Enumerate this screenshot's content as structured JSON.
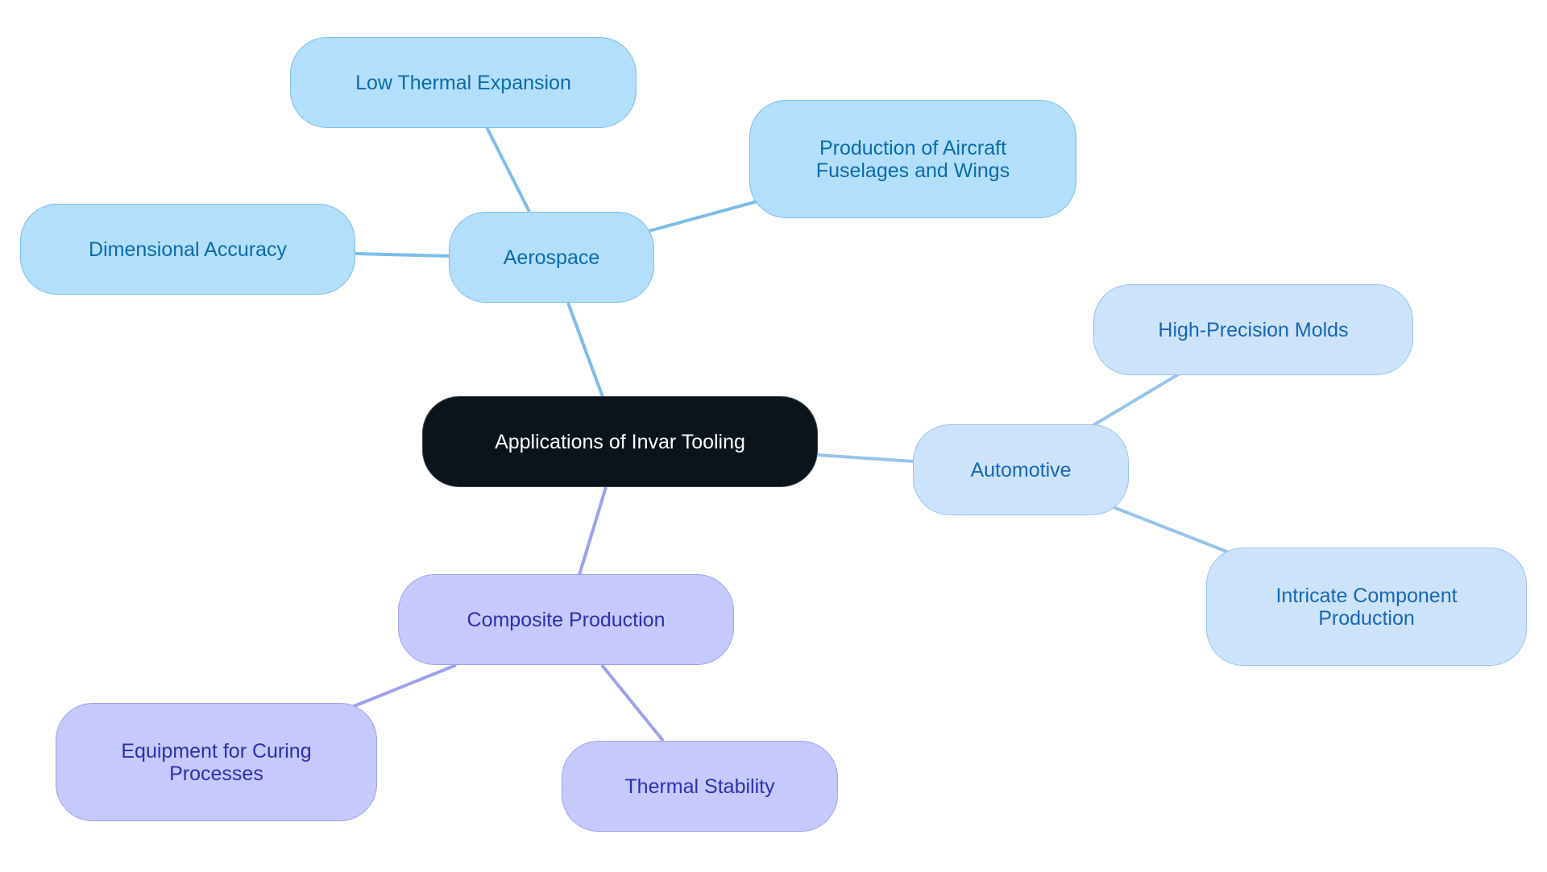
{
  "diagram": {
    "type": "mind-map",
    "root": {
      "id": "root",
      "label": "Applications of Invar Tooling"
    },
    "branches": [
      {
        "id": "aerospace",
        "label": "Aerospace",
        "color_group": "aero",
        "children": [
          {
            "id": "low-thermal",
            "label": "Low Thermal Expansion"
          },
          {
            "id": "aircraft",
            "label": "Production of Aircraft\nFuselages and Wings"
          },
          {
            "id": "dimensional",
            "label": "Dimensional Accuracy"
          }
        ]
      },
      {
        "id": "automotive",
        "label": "Automotive",
        "color_group": "auto",
        "children": [
          {
            "id": "molds",
            "label": "High-Precision Molds"
          },
          {
            "id": "intricate",
            "label": "Intricate Component\nProduction"
          }
        ]
      },
      {
        "id": "composite",
        "label": "Composite Production",
        "color_group": "comp",
        "children": [
          {
            "id": "curing",
            "label": "Equipment for Curing\nProcesses"
          },
          {
            "id": "thermal-stability",
            "label": "Thermal Stability"
          }
        ]
      }
    ],
    "colors": {
      "root_fill": "#0c141b",
      "aero_fill": "#b3dffd",
      "aero_edge": "#7cbde8",
      "aero_text": "#0a6aab",
      "auto_fill": "#cce3fb",
      "auto_edge": "#98c3ec",
      "auto_text": "#1766b7",
      "comp_fill": "#c6c9fd",
      "comp_edge": "#9da1ee",
      "comp_text": "#2f2db0"
    }
  }
}
